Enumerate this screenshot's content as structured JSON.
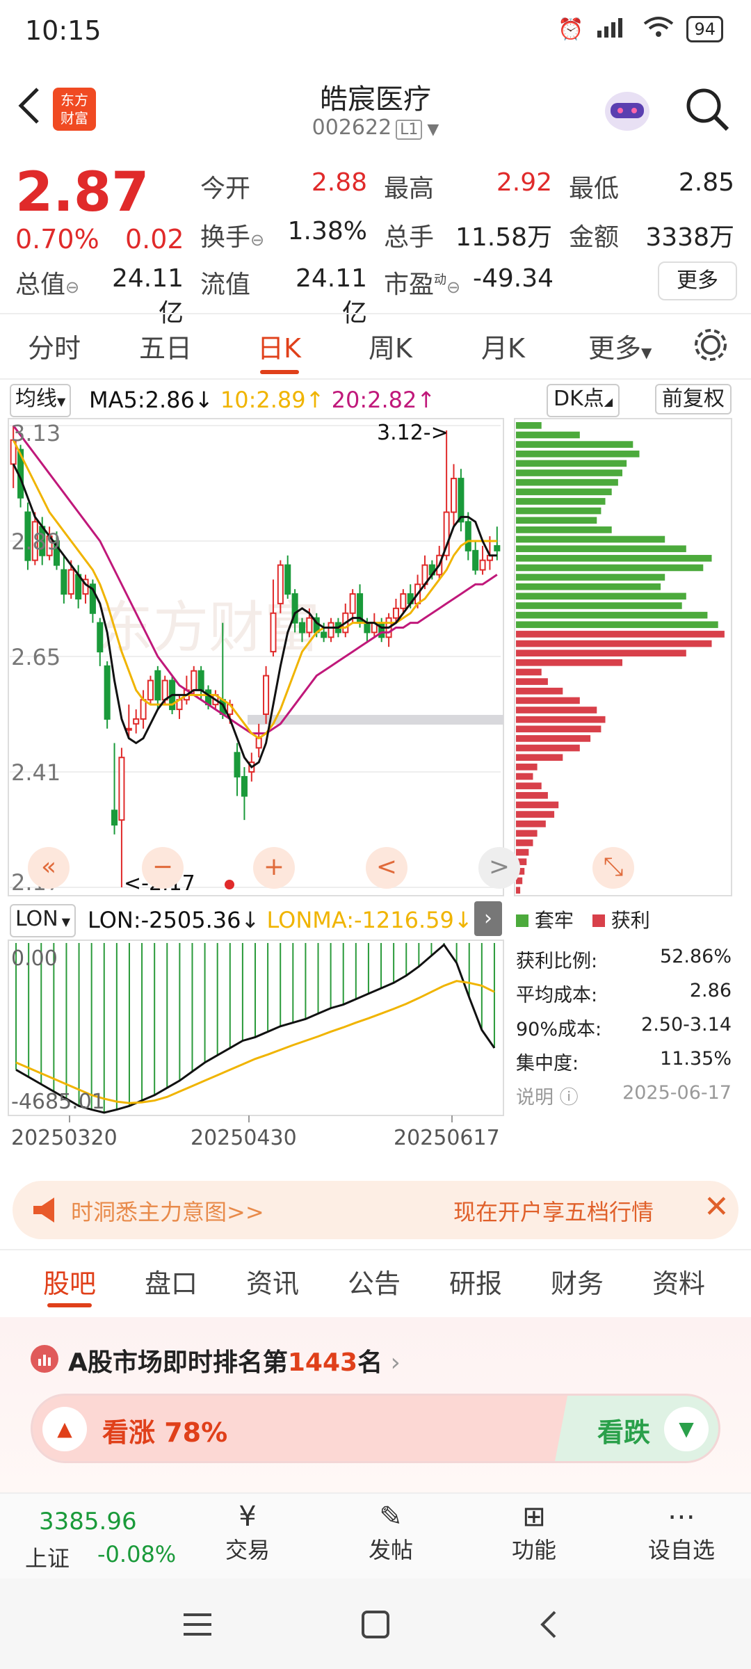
{
  "status_bar": {
    "time": "10:15",
    "battery": "94"
  },
  "header": {
    "stock_name": "皓宸医疗",
    "stock_code": "002622",
    "level": "L1",
    "logo_line1": "东方",
    "logo_line2": "财富"
  },
  "quote": {
    "price": "2.87",
    "change_pct": "0.70%",
    "change": "0.02",
    "open_label": "今开",
    "open": "2.88",
    "high_label": "最高",
    "high": "2.92",
    "low_label": "最低",
    "low": "2.85",
    "turnover_label": "换手",
    "turnover": "1.38%",
    "volume_label": "总手",
    "volume": "11.58万",
    "amount_label": "金额",
    "amount": "3338万",
    "mktcap_label": "总值",
    "mktcap": "24.11亿",
    "float_label": "流值",
    "float_cap": "24.11亿",
    "pe_label": "市盈",
    "pe_sup": "动",
    "pe": "-49.34",
    "more_label": "更多"
  },
  "period_tabs": [
    "分时",
    "五日",
    "日K",
    "周K",
    "月K",
    "更多"
  ],
  "active_tab": "日K",
  "chart_header": {
    "ma_selector": "均线",
    "ma5": "MA5:2.86",
    "ma10": "10:2.89",
    "ma20": "20:2.82",
    "dk_label": "DK点",
    "adjust_label": "前复权"
  },
  "chart_data": {
    "type": "candlestick",
    "y_ticks": [
      "3.13",
      "2.89",
      "2.65",
      "2.41",
      "2.17"
    ],
    "ylim": [
      2.17,
      3.13
    ],
    "high_annotation": "3.12->",
    "low_annotation": "<-2.17",
    "x_ticks": [
      "20250320",
      "20250430",
      "20250617"
    ],
    "colors": {
      "up": "#e02a2a",
      "down": "#1a9a3a",
      "ma5": "#111111",
      "ma10": "#f0b400",
      "ma20": "#c0187a"
    },
    "candles": [
      {
        "o": 3.05,
        "c": 3.1,
        "h": 3.13,
        "l": 3.0
      },
      {
        "o": 3.08,
        "c": 2.98,
        "h": 3.09,
        "l": 2.96
      },
      {
        "o": 2.95,
        "c": 2.85,
        "h": 2.97,
        "l": 2.83
      },
      {
        "o": 2.85,
        "c": 2.93,
        "h": 2.95,
        "l": 2.84
      },
      {
        "o": 2.92,
        "c": 2.86,
        "h": 2.94,
        "l": 2.84
      },
      {
        "o": 2.86,
        "c": 2.9,
        "h": 2.92,
        "l": 2.85
      },
      {
        "o": 2.89,
        "c": 2.84,
        "h": 2.91,
        "l": 2.83
      },
      {
        "o": 2.83,
        "c": 2.78,
        "h": 2.86,
        "l": 2.76
      },
      {
        "o": 2.78,
        "c": 2.83,
        "h": 2.85,
        "l": 2.77
      },
      {
        "o": 2.82,
        "c": 2.77,
        "h": 2.84,
        "l": 2.75
      },
      {
        "o": 2.78,
        "c": 2.81,
        "h": 2.82,
        "l": 2.76
      },
      {
        "o": 2.8,
        "c": 2.74,
        "h": 2.81,
        "l": 2.72
      },
      {
        "o": 2.72,
        "c": 2.66,
        "h": 2.73,
        "l": 2.63
      },
      {
        "o": 2.63,
        "c": 2.52,
        "h": 2.64,
        "l": 2.5
      },
      {
        "o": 2.33,
        "c": 2.3,
        "h": 2.47,
        "l": 2.28
      },
      {
        "o": 2.31,
        "c": 2.44,
        "h": 2.46,
        "l": 2.17
      },
      {
        "o": 2.5,
        "c": 2.5,
        "h": 2.55,
        "l": 2.48
      },
      {
        "o": 2.51,
        "c": 2.52,
        "h": 2.54,
        "l": 2.49
      },
      {
        "o": 2.52,
        "c": 2.56,
        "h": 2.58,
        "l": 2.5
      },
      {
        "o": 2.56,
        "c": 2.6,
        "h": 2.61,
        "l": 2.55
      },
      {
        "o": 2.62,
        "c": 2.56,
        "h": 2.63,
        "l": 2.54
      },
      {
        "o": 2.56,
        "c": 2.6,
        "h": 2.61,
        "l": 2.55
      },
      {
        "o": 2.6,
        "c": 2.54,
        "h": 2.61,
        "l": 2.53
      },
      {
        "o": 2.54,
        "c": 2.56,
        "h": 2.57,
        "l": 2.52
      },
      {
        "o": 2.56,
        "c": 2.58,
        "h": 2.61,
        "l": 2.55
      },
      {
        "o": 2.58,
        "c": 2.62,
        "h": 2.63,
        "l": 2.57
      },
      {
        "o": 2.62,
        "c": 2.58,
        "h": 2.63,
        "l": 2.56
      },
      {
        "o": 2.58,
        "c": 2.55,
        "h": 2.59,
        "l": 2.54
      },
      {
        "o": 2.55,
        "c": 2.57,
        "h": 2.58,
        "l": 2.54
      },
      {
        "o": 2.56,
        "c": 2.53,
        "h": 2.72,
        "l": 2.52
      },
      {
        "o": 2.53,
        "c": 2.55,
        "h": 2.56,
        "l": 2.51
      },
      {
        "o": 2.45,
        "c": 2.4,
        "h": 2.47,
        "l": 2.36
      },
      {
        "o": 2.4,
        "c": 2.36,
        "h": 2.42,
        "l": 2.31
      },
      {
        "o": 2.41,
        "c": 2.43,
        "h": 2.45,
        "l": 2.39
      },
      {
        "o": 2.46,
        "c": 2.48,
        "h": 2.51,
        "l": 2.44
      },
      {
        "o": 2.53,
        "c": 2.61,
        "h": 2.63,
        "l": 2.51
      },
      {
        "o": 2.66,
        "c": 2.74,
        "h": 2.81,
        "l": 2.65
      },
      {
        "o": 2.76,
        "c": 2.84,
        "h": 2.85,
        "l": 2.74
      },
      {
        "o": 2.84,
        "c": 2.78,
        "h": 2.86,
        "l": 2.77
      },
      {
        "o": 2.78,
        "c": 2.72,
        "h": 2.79,
        "l": 2.7
      },
      {
        "o": 2.72,
        "c": 2.7,
        "h": 2.73,
        "l": 2.68
      },
      {
        "o": 2.7,
        "c": 2.73,
        "h": 2.75,
        "l": 2.69
      },
      {
        "o": 2.73,
        "c": 2.7,
        "h": 2.74,
        "l": 2.69
      },
      {
        "o": 2.7,
        "c": 2.69,
        "h": 2.72,
        "l": 2.68
      },
      {
        "o": 2.69,
        "c": 2.72,
        "h": 2.73,
        "l": 2.68
      },
      {
        "o": 2.72,
        "c": 2.7,
        "h": 2.73,
        "l": 2.69
      },
      {
        "o": 2.7,
        "c": 2.74,
        "h": 2.76,
        "l": 2.69
      },
      {
        "o": 2.74,
        "c": 2.78,
        "h": 2.79,
        "l": 2.72
      },
      {
        "o": 2.78,
        "c": 2.72,
        "h": 2.8,
        "l": 2.71
      },
      {
        "o": 2.72,
        "c": 2.7,
        "h": 2.73,
        "l": 2.68
      },
      {
        "o": 2.7,
        "c": 2.72,
        "h": 2.74,
        "l": 2.69
      },
      {
        "o": 2.72,
        "c": 2.69,
        "h": 2.73,
        "l": 2.68
      },
      {
        "o": 2.69,
        "c": 2.73,
        "h": 2.74,
        "l": 2.67
      },
      {
        "o": 2.73,
        "c": 2.75,
        "h": 2.77,
        "l": 2.72
      },
      {
        "o": 2.75,
        "c": 2.78,
        "h": 2.79,
        "l": 2.74
      },
      {
        "o": 2.78,
        "c": 2.76,
        "h": 2.8,
        "l": 2.75
      },
      {
        "o": 2.76,
        "c": 2.8,
        "h": 2.82,
        "l": 2.75
      },
      {
        "o": 2.8,
        "c": 2.84,
        "h": 2.86,
        "l": 2.79
      },
      {
        "o": 2.84,
        "c": 2.82,
        "h": 2.85,
        "l": 2.81
      },
      {
        "o": 2.82,
        "c": 2.86,
        "h": 2.88,
        "l": 2.81
      },
      {
        "o": 2.86,
        "c": 2.95,
        "h": 3.12,
        "l": 2.85
      },
      {
        "o": 2.95,
        "c": 3.02,
        "h": 3.05,
        "l": 2.92
      },
      {
        "o": 3.02,
        "c": 2.93,
        "h": 3.04,
        "l": 2.91
      },
      {
        "o": 2.93,
        "c": 2.87,
        "h": 2.95,
        "l": 2.85
      },
      {
        "o": 2.87,
        "c": 2.83,
        "h": 2.89,
        "l": 2.82
      },
      {
        "o": 2.83,
        "c": 2.85,
        "h": 2.88,
        "l": 2.82
      },
      {
        "o": 2.85,
        "c": 2.86,
        "h": 2.9,
        "l": 2.83
      },
      {
        "o": 2.88,
        "c": 2.87,
        "h": 2.92,
        "l": 2.85
      }
    ],
    "ma5": [
      3.05,
      3.02,
      2.98,
      2.94,
      2.92,
      2.9,
      2.88,
      2.86,
      2.84,
      2.82,
      2.8,
      2.79,
      2.76,
      2.7,
      2.6,
      2.52,
      2.48,
      2.47,
      2.48,
      2.51,
      2.54,
      2.56,
      2.57,
      2.57,
      2.57,
      2.58,
      2.58,
      2.57,
      2.56,
      2.55,
      2.52,
      2.48,
      2.44,
      2.42,
      2.43,
      2.47,
      2.55,
      2.63,
      2.7,
      2.74,
      2.75,
      2.74,
      2.72,
      2.71,
      2.71,
      2.71,
      2.72,
      2.73,
      2.73,
      2.72,
      2.72,
      2.71,
      2.71,
      2.72,
      2.74,
      2.76,
      2.78,
      2.8,
      2.82,
      2.84,
      2.88,
      2.92,
      2.94,
      2.94,
      2.93,
      2.89,
      2.86,
      2.86
    ],
    "ma10": [
      3.1,
      3.07,
      3.04,
      3.01,
      2.98,
      2.95,
      2.93,
      2.91,
      2.89,
      2.87,
      2.85,
      2.83,
      2.8,
      2.76,
      2.71,
      2.66,
      2.62,
      2.58,
      2.56,
      2.55,
      2.55,
      2.55,
      2.55,
      2.56,
      2.57,
      2.57,
      2.57,
      2.57,
      2.57,
      2.56,
      2.55,
      2.53,
      2.51,
      2.49,
      2.48,
      2.49,
      2.51,
      2.54,
      2.58,
      2.62,
      2.66,
      2.68,
      2.7,
      2.71,
      2.71,
      2.71,
      2.71,
      2.72,
      2.72,
      2.72,
      2.72,
      2.72,
      2.72,
      2.72,
      2.73,
      2.74,
      2.76,
      2.77,
      2.79,
      2.81,
      2.83,
      2.86,
      2.88,
      2.89,
      2.89,
      2.89,
      2.89,
      2.89
    ],
    "ma20": [
      3.13,
      3.11,
      3.09,
      3.07,
      3.05,
      3.03,
      3.01,
      2.99,
      2.97,
      2.95,
      2.93,
      2.91,
      2.89,
      2.86,
      2.83,
      2.8,
      2.77,
      2.74,
      2.71,
      2.68,
      2.65,
      2.63,
      2.61,
      2.59,
      2.58,
      2.57,
      2.56,
      2.55,
      2.54,
      2.53,
      2.52,
      2.51,
      2.5,
      2.49,
      2.49,
      2.49,
      2.5,
      2.51,
      2.53,
      2.55,
      2.57,
      2.59,
      2.61,
      2.62,
      2.63,
      2.64,
      2.65,
      2.66,
      2.67,
      2.68,
      2.69,
      2.7,
      2.7,
      2.71,
      2.71,
      2.72,
      2.72,
      2.73,
      2.74,
      2.75,
      2.76,
      2.77,
      2.78,
      2.79,
      2.8,
      2.8,
      2.81,
      2.82
    ],
    "chip_distribution": {
      "trapped_color": "#4caa3c",
      "profit_color": "#d8404a",
      "rows": [
        0.12,
        0.3,
        0.55,
        0.58,
        0.52,
        0.5,
        0.48,
        0.45,
        0.42,
        0.4,
        0.38,
        0.45,
        0.7,
        0.8,
        0.92,
        0.88,
        0.7,
        0.68,
        0.8,
        0.78,
        0.9,
        0.95,
        0.98,
        0.92,
        0.8,
        0.5,
        0.12,
        0.15,
        0.22,
        0.3,
        0.38,
        0.42,
        0.4,
        0.35,
        0.3,
        0.22,
        0.1,
        0.08,
        0.12,
        0.15,
        0.2,
        0.18,
        0.14,
        0.1,
        0.08,
        0.06,
        0.05,
        0.04,
        0.03,
        0.02
      ],
      "profit_start_index": 22
    },
    "indicator": {
      "name": "LON",
      "lon": "LON:-2505.36",
      "lonma": "LONMA:-1216.59",
      "y_ticks": [
        "0.00",
        "-4685.01"
      ],
      "ylim": [
        -4685.01,
        0.0
      ],
      "lon_values": [
        -3500,
        -3700,
        -3900,
        -4100,
        -4300,
        -4500,
        -4600,
        -4685,
        -4600,
        -4500,
        -4350,
        -4200,
        -4000,
        -3800,
        -3550,
        -3300,
        -3100,
        -2900,
        -2700,
        -2600,
        -2450,
        -2300,
        -2200,
        -2100,
        -1950,
        -1800,
        -1700,
        -1550,
        -1400,
        -1250,
        -1100,
        -900,
        -650,
        -350,
        -50,
        -550,
        -1500,
        -2400,
        -2900
      ],
      "lonma_values": [
        -3300,
        -3450,
        -3600,
        -3750,
        -3900,
        -4050,
        -4200,
        -4300,
        -4380,
        -4420,
        -4400,
        -4350,
        -4250,
        -4100,
        -3950,
        -3800,
        -3650,
        -3500,
        -3350,
        -3200,
        -3080,
        -2950,
        -2820,
        -2700,
        -2580,
        -2450,
        -2330,
        -2200,
        -2080,
        -1950,
        -1820,
        -1680,
        -1520,
        -1350,
        -1180,
        -1050,
        -1100,
        -1180,
        -1350
      ]
    }
  },
  "chart_controls": {
    "left": "«",
    "minus": "−",
    "plus": "+",
    "prev": "<",
    "next": ">"
  },
  "chip_panel": {
    "legend_trapped": "套牢",
    "legend_profit": "获利",
    "rows": [
      {
        "label": "获利比例:",
        "value": "52.86%"
      },
      {
        "label": "平均成本:",
        "value": "2.86"
      },
      {
        "label": "90%成本:",
        "value": "2.50-3.14"
      },
      {
        "label": "集中度:",
        "value": "11.35%"
      }
    ],
    "note_label": "说明",
    "date": "2025-06-17"
  },
  "banner": {
    "left_text": "时洞悉主力意图>>",
    "right_text": "现在开户享五档行情"
  },
  "section_tabs": [
    "股吧",
    "盘口",
    "资讯",
    "公告",
    "研报",
    "财务",
    "资料"
  ],
  "active_section": "股吧",
  "ranking": {
    "prefix": "A股市场即时排名第",
    "rank": "1443",
    "suffix": "名"
  },
  "sentiment": {
    "up_label": "看涨 78%",
    "up_fraction": 0.78,
    "down_label": "看跌"
  },
  "footer": {
    "index_value": "3385.96",
    "index_name": "上证",
    "index_change": "-0.08%",
    "items": [
      {
        "label": "交易",
        "icon": "yen-exchange-icon"
      },
      {
        "label": "发帖",
        "icon": "edit-icon"
      },
      {
        "label": "功能",
        "icon": "grid-icon"
      },
      {
        "label": "设自选",
        "icon": "more-icon"
      }
    ]
  }
}
